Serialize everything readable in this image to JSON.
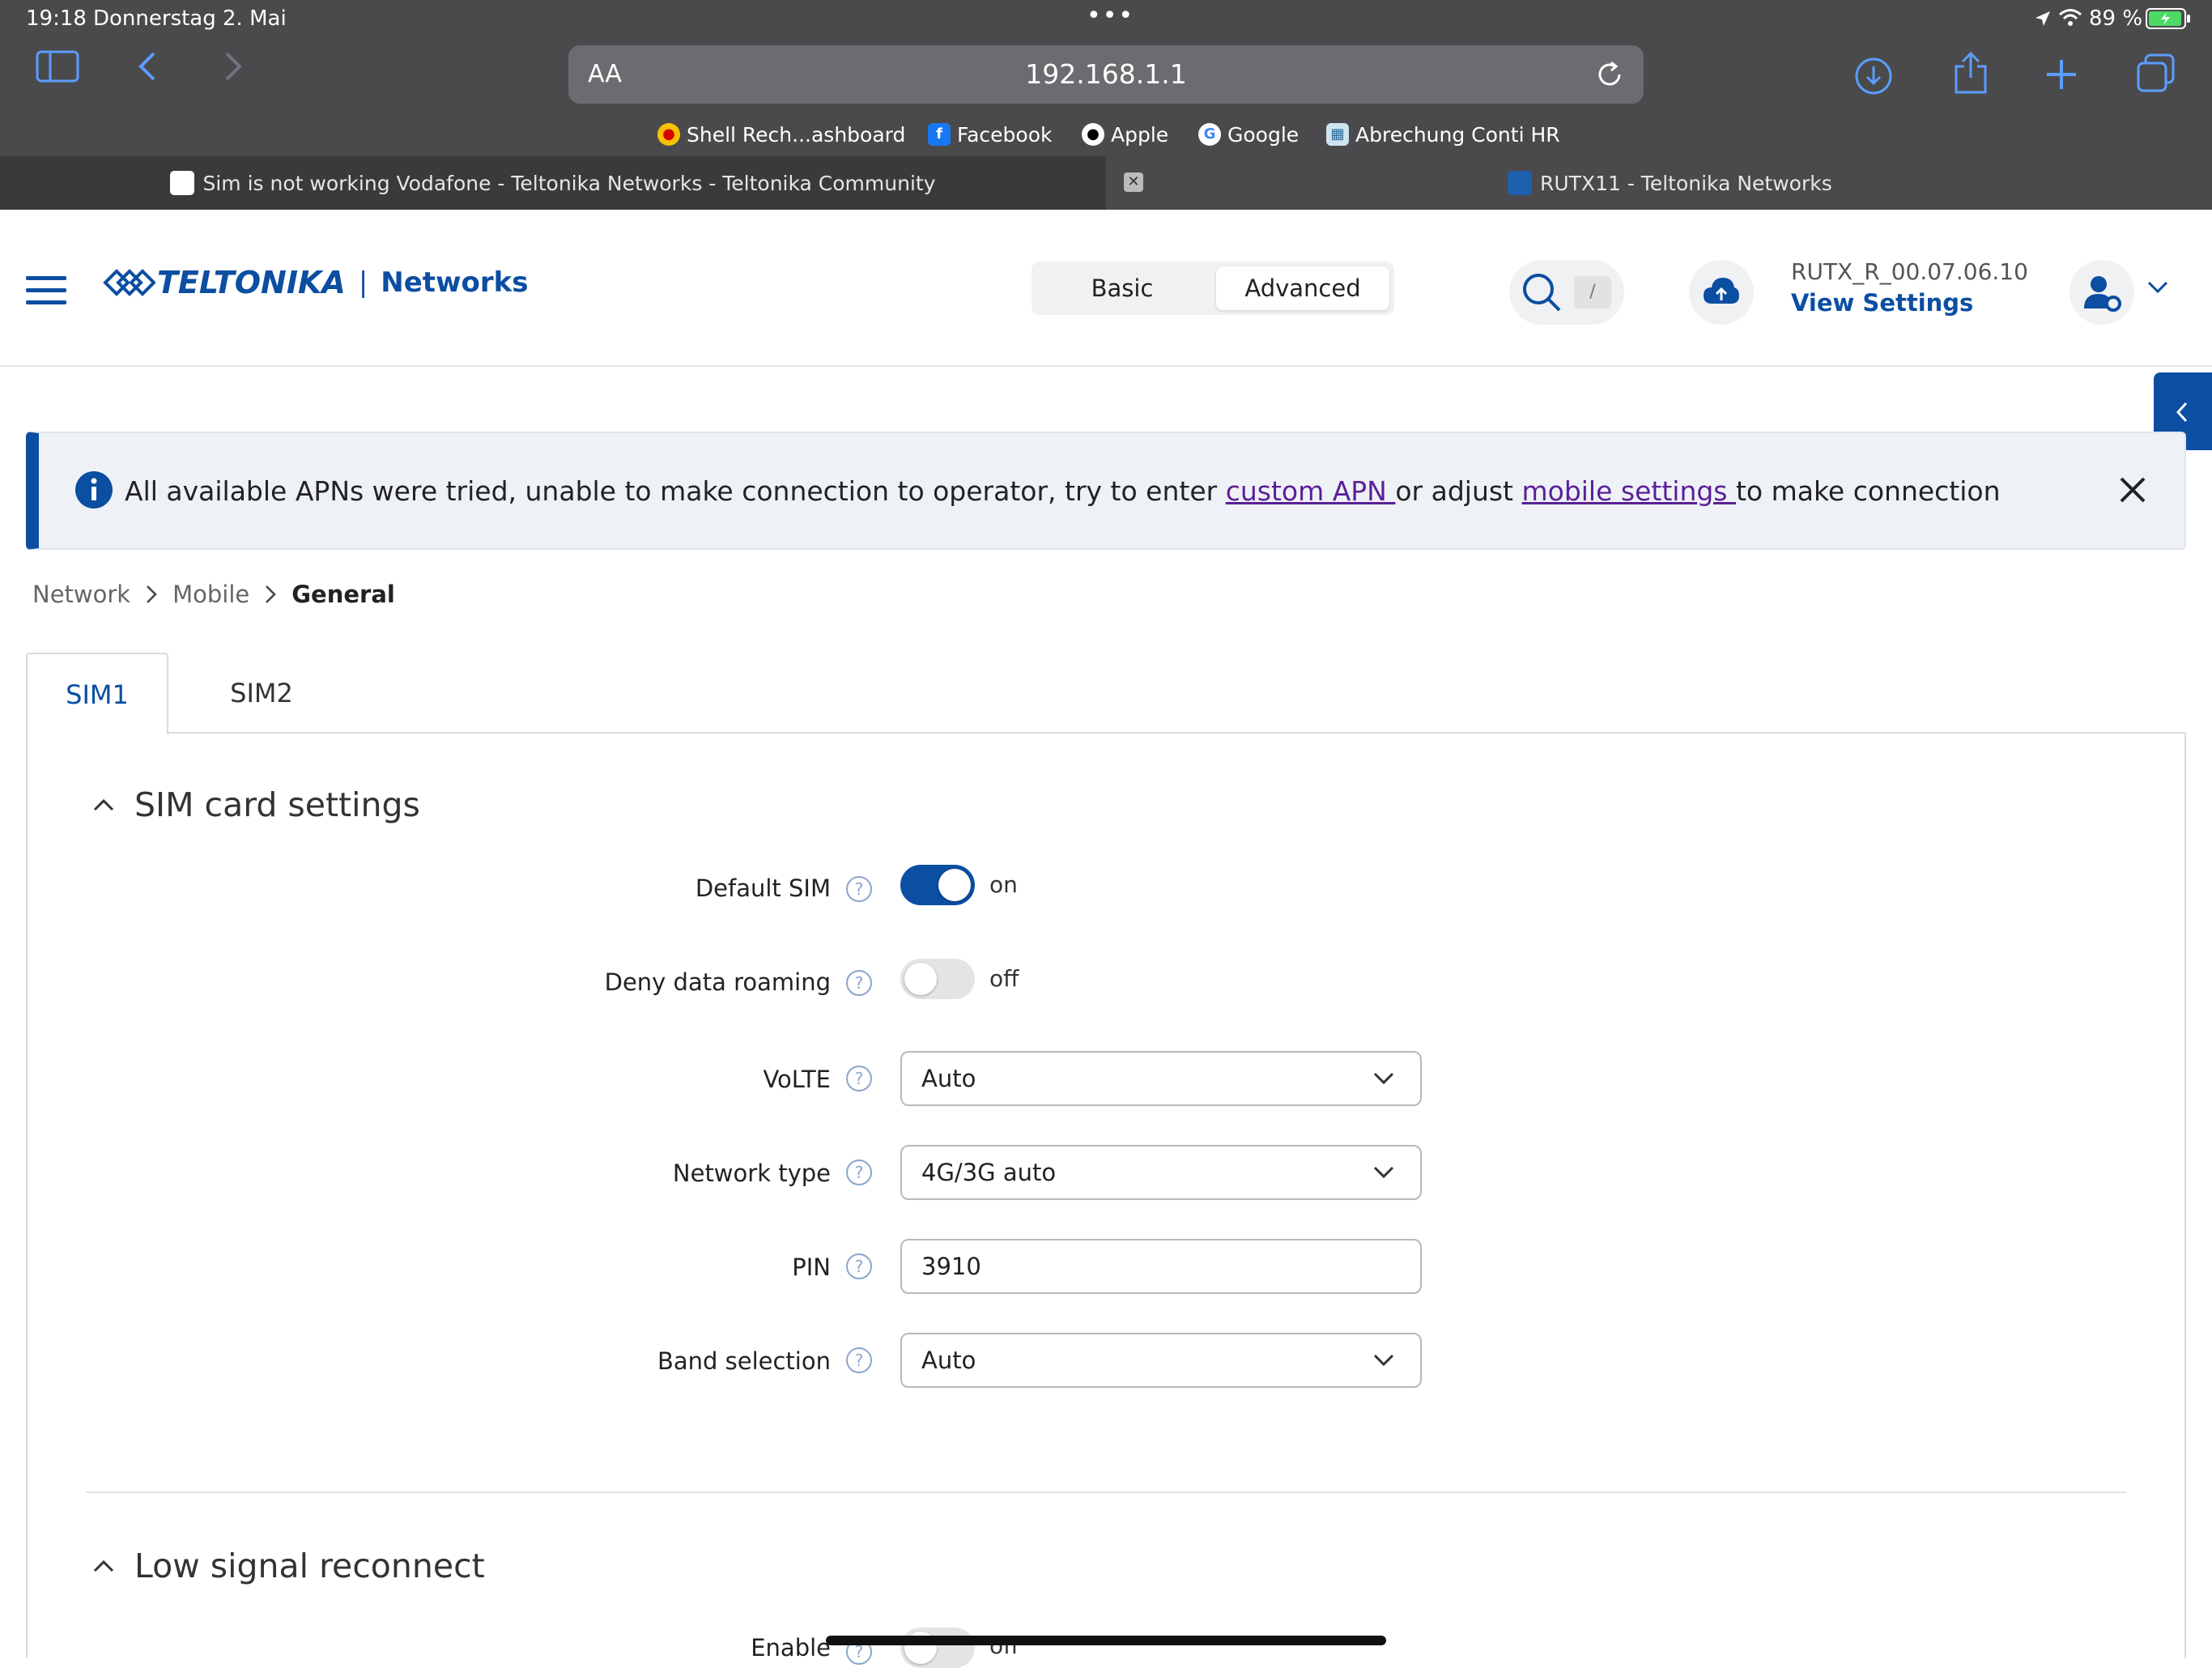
{
  "status_bar": {
    "time": "19:18",
    "date": "Donnerstag 2. Mai",
    "battery": "89 %"
  },
  "browser": {
    "url": "192.168.1.1",
    "text_size_label": "AA",
    "bookmarks": [
      {
        "label": "Shell Rech...ashboard"
      },
      {
        "label": "Facebook"
      },
      {
        "label": "Apple"
      },
      {
        "label": "Google"
      },
      {
        "label": "Abrechung Conti  HR"
      }
    ],
    "tabs": [
      {
        "label": "Sim is not working Vodafone - Teltonika Networks - Teltonika Community"
      },
      {
        "label": "RUTX11 - Teltonika Networks"
      }
    ]
  },
  "header": {
    "brand": "TELTONIKA",
    "brand_sub": "Networks",
    "modes": [
      "Basic",
      "Advanced"
    ],
    "search_shortcut": "/",
    "firmware": "RUTX_R_00.07.06.10",
    "view_settings": "View Settings"
  },
  "alert": {
    "text_before": "All available APNs were tried, unable to make connection to operator, try to enter ",
    "link1": "custom APN ",
    "text_middle": "or adjust ",
    "link2": "mobile settings ",
    "text_after": "to make connection"
  },
  "breadcrumb": [
    "Network",
    "Mobile",
    "General"
  ],
  "sim_tabs": [
    "SIM1",
    "SIM2"
  ],
  "sim_card_settings": {
    "title": "SIM card settings",
    "default_sim": {
      "label": "Default SIM",
      "state": "on"
    },
    "deny_roaming": {
      "label": "Deny data roaming",
      "state": "off"
    },
    "volte": {
      "label": "VoLTE",
      "value": "Auto"
    },
    "network_type": {
      "label": "Network type",
      "value": "4G/3G auto"
    },
    "pin": {
      "label": "PIN",
      "value": "3910"
    },
    "band_selection": {
      "label": "Band selection",
      "value": "Auto"
    }
  },
  "low_signal": {
    "title": "Low signal reconnect",
    "enable": {
      "label": "Enable",
      "state": "off"
    }
  },
  "colors": {
    "brand": "#0b4ea2",
    "link_visited": "#5a1f99",
    "safari_accent": "#5b9dff"
  }
}
